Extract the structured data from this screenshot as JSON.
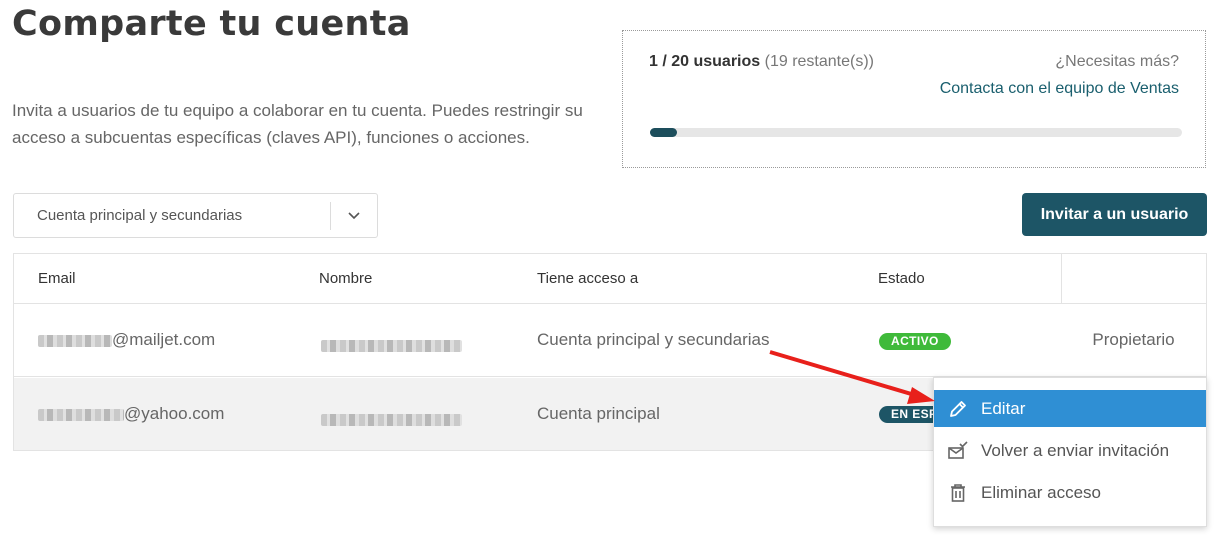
{
  "page": {
    "title": "Comparte tu cuenta",
    "intro_line1": "Invita a usuarios de tu equipo a colaborar en tu cuenta. Puedes restringir su",
    "intro_line2": "acceso a subcuentas específicas (claves API), funciones o acciones."
  },
  "quota": {
    "count": "1 / 20 usuarios",
    "remaining": "(19 restante(s))",
    "need_more": "¿Necesitas más?",
    "contact_link": "Contacta con el equipo de Ventas",
    "progress_fraction": 0.05
  },
  "filter": {
    "selected": "Cuenta principal y secundarias",
    "icon": "chevron-down-icon"
  },
  "invite_button": "Invitar a un usuario",
  "table": {
    "headers": {
      "email": "Email",
      "name": "Nombre",
      "access": "Tiene acceso a",
      "status": "Estado"
    },
    "rows": [
      {
        "email_suffix": "@mailjet.com",
        "access": "Cuenta principal y secundarias",
        "status": "ACTIVO",
        "role": "Propietario"
      },
      {
        "email_suffix": "@yahoo.com",
        "access": "Cuenta principal",
        "status": "EN ESP"
      }
    ]
  },
  "menu": {
    "items": [
      {
        "label": "Editar",
        "icon": "pencil-icon"
      },
      {
        "label": "Volver a enviar invitación",
        "icon": "envelope-check-icon"
      },
      {
        "label": "Eliminar acceso",
        "icon": "trash-icon"
      }
    ]
  },
  "colors": {
    "primary": "#1d5566",
    "active": "#3fba3a",
    "menu_highlight": "#2f8fd4",
    "annotation_arrow": "#e8201b"
  }
}
